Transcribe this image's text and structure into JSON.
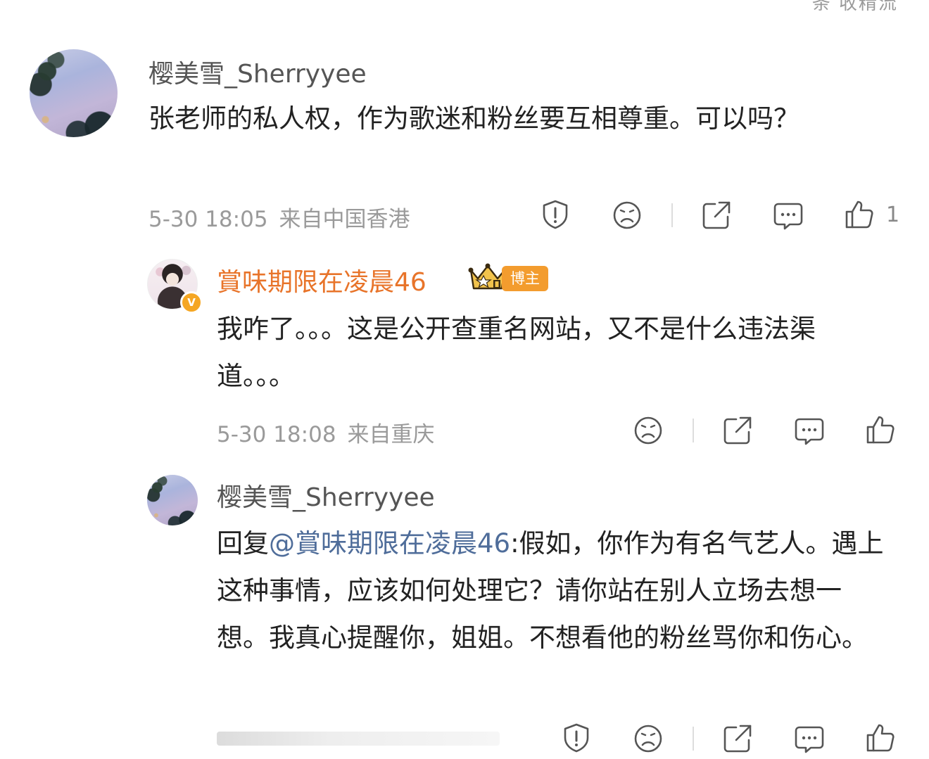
{
  "top_cutoff": "条 收精流",
  "comments": [
    {
      "username": "樱美雪_Sherryyee",
      "text": "张老师的私人权，作为歌迷和粉丝要互相尊重。可以吗？",
      "date": "5-30 18:05",
      "location": "来自中国香港",
      "like_count": "1"
    },
    {
      "username": "賞味期限在凌晨46",
      "badge": "博主",
      "verified_mark": "V",
      "text": "我咋了。。。这是公开查重名网站，又不是什么违法渠道。。。",
      "date": "5-30 18:08",
      "location": "来自重庆"
    },
    {
      "username": "樱美雪_Sherryyee",
      "reply_prefix": "回复",
      "reply_mention": "@賞味期限在凌晨46",
      "text": ":假如，你作为有名气艺人。遇上这种事情，应该如何处理它？请你站在别人立场去想一想。我真心提醒你，姐姐。不想看他的粉丝骂你和伤心。"
    }
  ],
  "icons": {
    "report": "report-icon",
    "dislike": "dislike-face-icon",
    "share": "share-icon",
    "comment": "comment-icon",
    "like": "thumbs-up-icon"
  },
  "colors": {
    "username_gray": "#555555",
    "blogger_orange": "#e8742a",
    "badge_orange": "#f39c2e",
    "mention_blue": "#4f6d9a",
    "meta_gray": "#9a9a9a"
  }
}
